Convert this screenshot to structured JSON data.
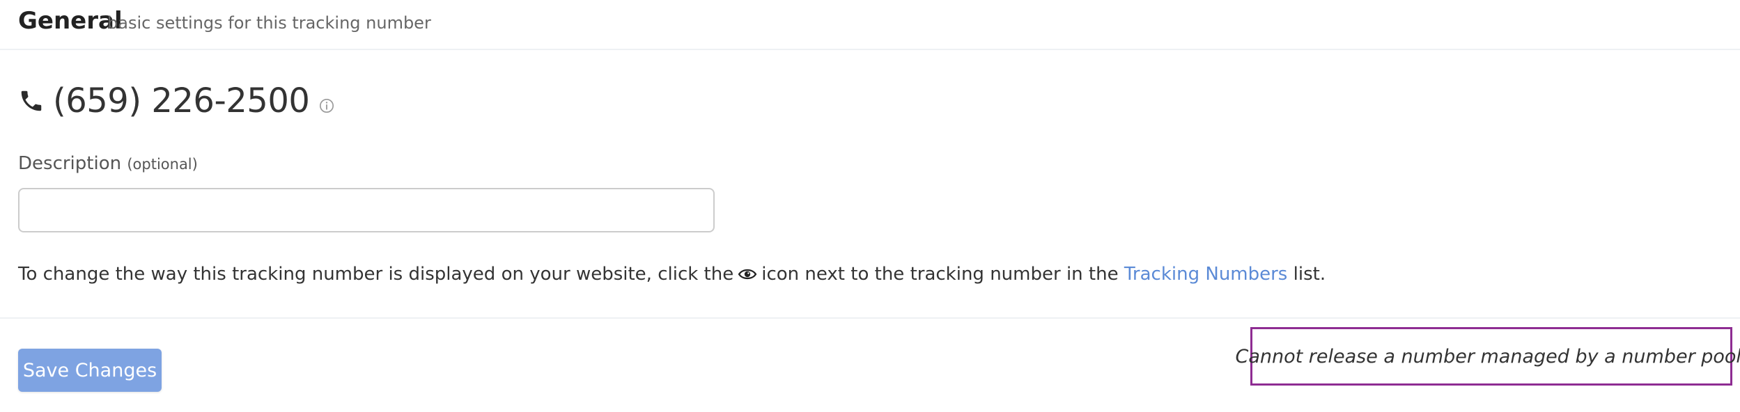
{
  "header": {
    "title": "General",
    "subtitle": "basic settings for this tracking number"
  },
  "phone": {
    "icon": "phone-icon",
    "number": "(659) 226-2500",
    "info_icon": "info-icon"
  },
  "description": {
    "label": "Description",
    "optional": "(optional)",
    "value": "",
    "placeholder": ""
  },
  "info_text": {
    "before": "To change the way this tracking number is displayed on your website, click the",
    "icon": "eye-icon",
    "middle": "icon next to the tracking number in the",
    "link": "Tracking Numbers",
    "after": "list."
  },
  "actions": {
    "save_label": "Save Changes",
    "release_notice": "Cannot release a number managed by a number pool."
  },
  "colors": {
    "accent": "#7ea3e2",
    "link": "#5b8ad6",
    "highlight_border": "#8e2c92"
  }
}
